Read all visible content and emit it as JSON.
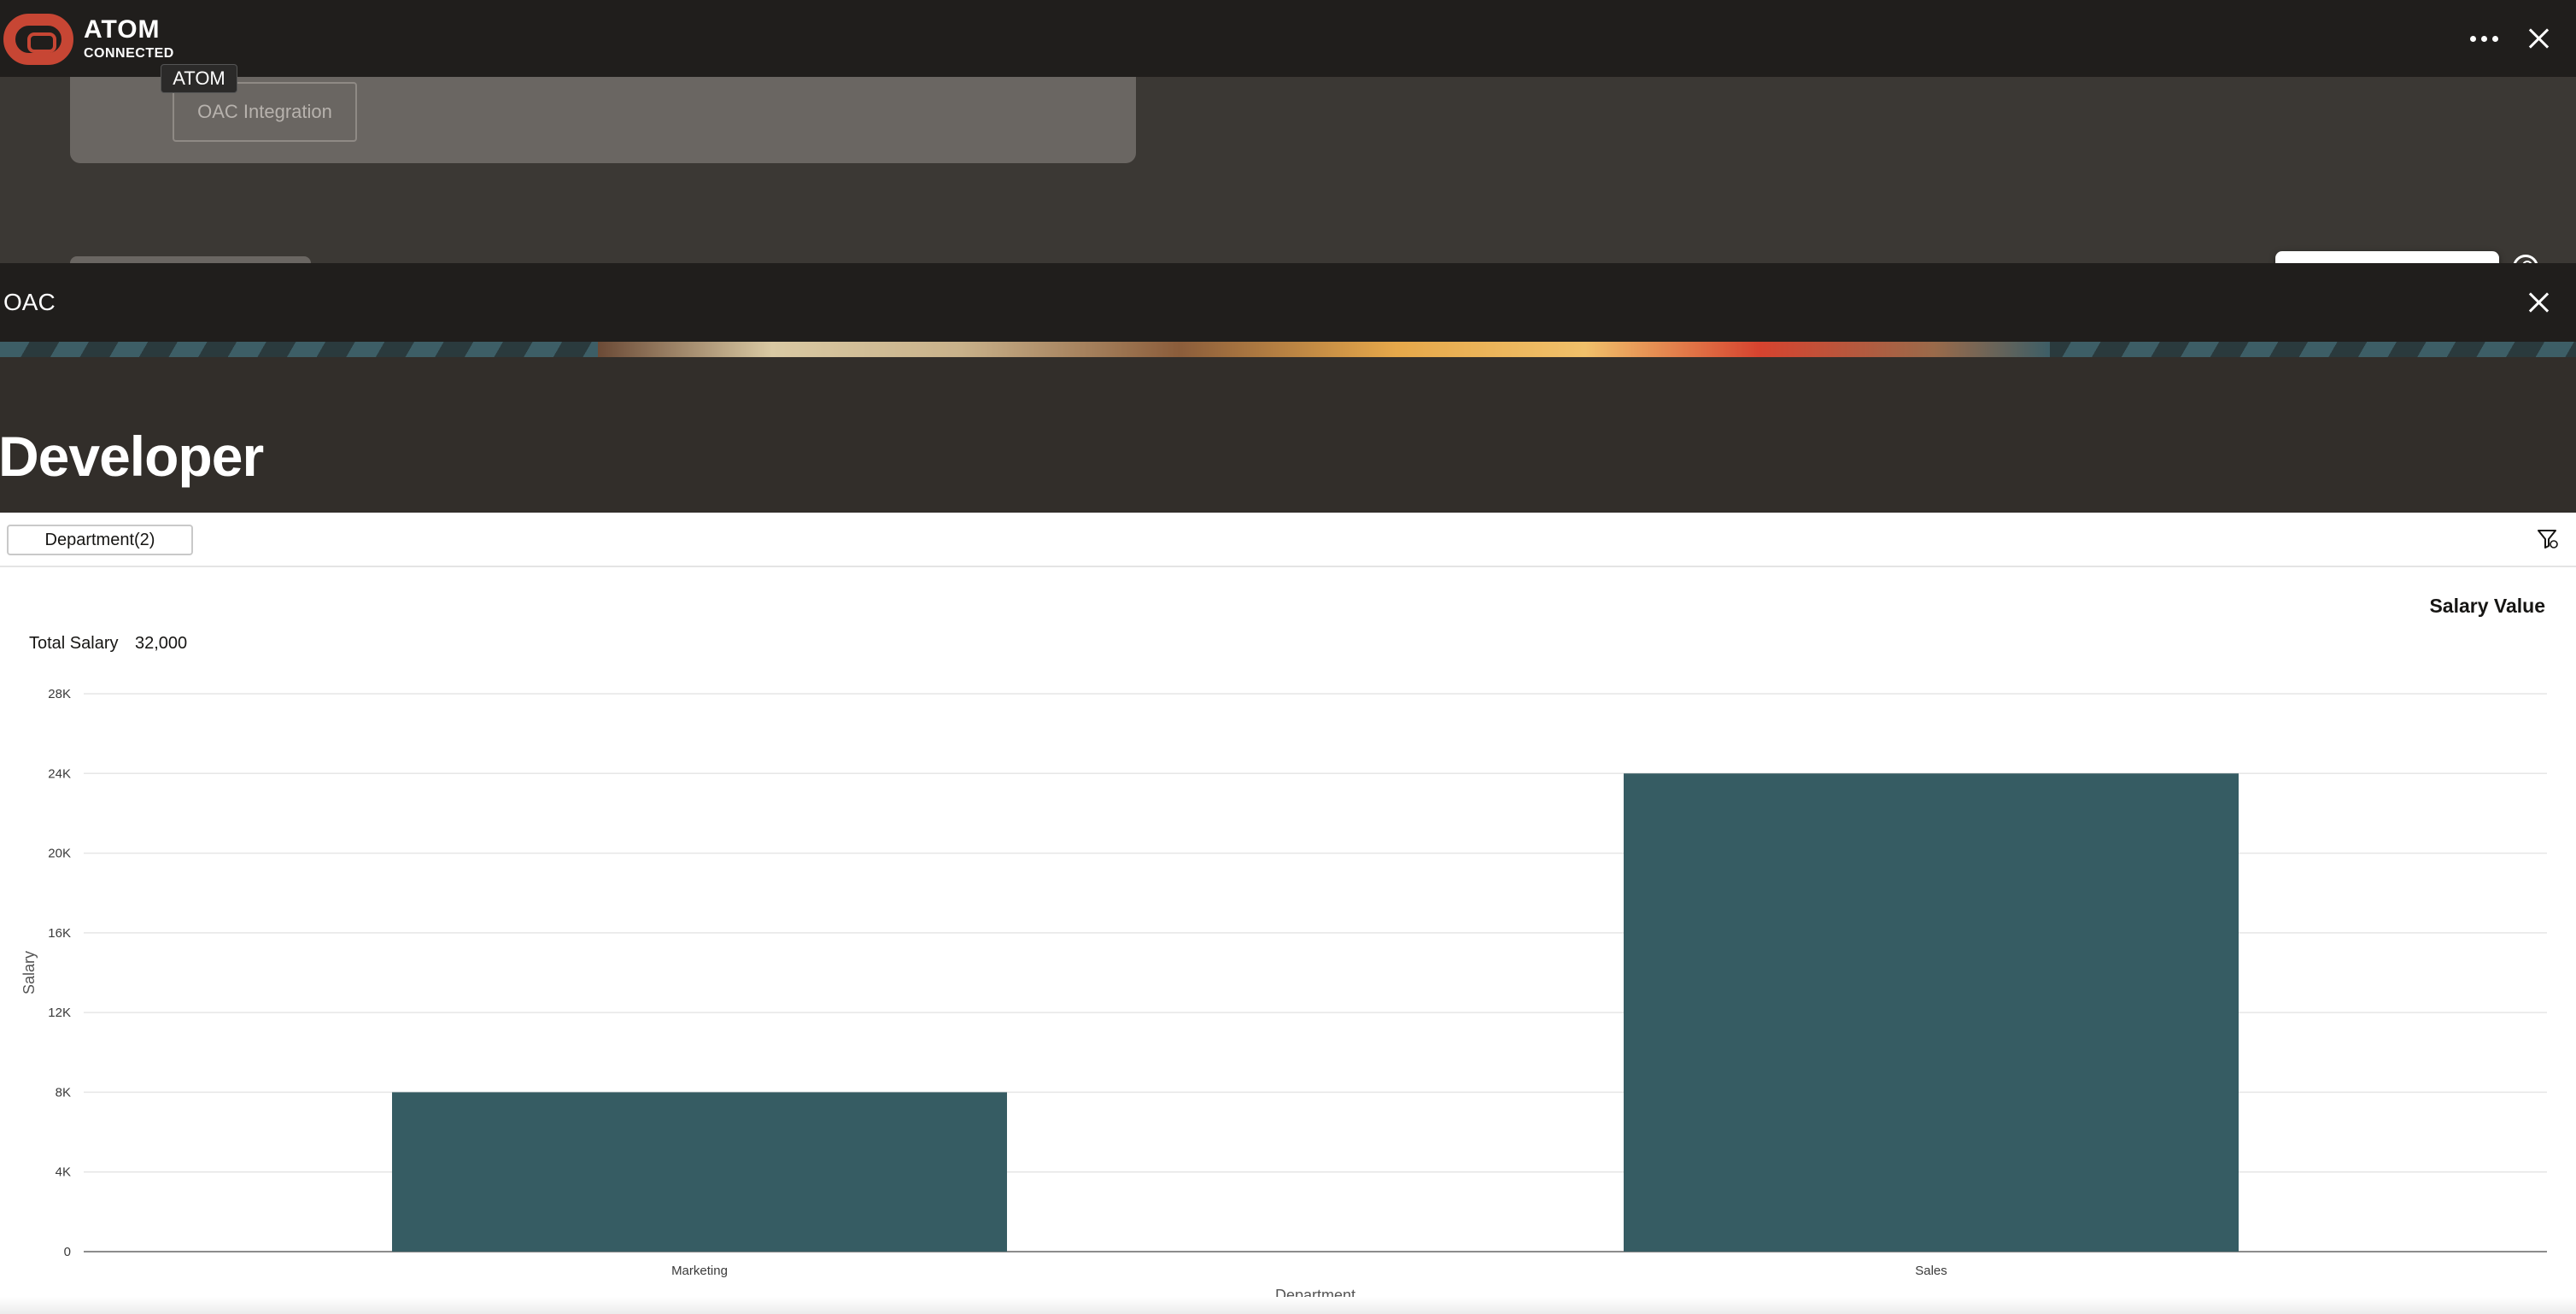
{
  "app": {
    "title": "ATOM",
    "status": "CONNECTED",
    "tooltip": "ATOM"
  },
  "background": {
    "button_label": "OAC Integration",
    "popup_label": "OAC Integration"
  },
  "panel": {
    "title": "OAC",
    "page_title": "Developer"
  },
  "filter": {
    "chip_label": "Department(2)"
  },
  "summary": {
    "label": "Total Salary",
    "value": "32,000"
  },
  "chart_heading": "Salary Value",
  "icons": {
    "more": "more-icon",
    "close": "close-icon",
    "user": "user-icon",
    "filter": "filter-icon",
    "logo": "oracle-logo-icon"
  },
  "colors": {
    "bar": "#365c63",
    "topbar": "#201e1c",
    "accent": "#c74634"
  },
  "chart_data": {
    "type": "bar",
    "categories": [
      "Marketing",
      "Sales"
    ],
    "values": [
      8000,
      24000
    ],
    "xlabel": "Department",
    "ylabel": "Salary",
    "ylim": [
      0,
      28000
    ],
    "yticks": [
      0,
      4000,
      8000,
      12000,
      16000,
      20000,
      24000,
      28000
    ],
    "ytick_labels": [
      "0",
      "4K",
      "8K",
      "12K",
      "16K",
      "20K",
      "24K",
      "28K"
    ],
    "grid": true,
    "legend": "none"
  }
}
